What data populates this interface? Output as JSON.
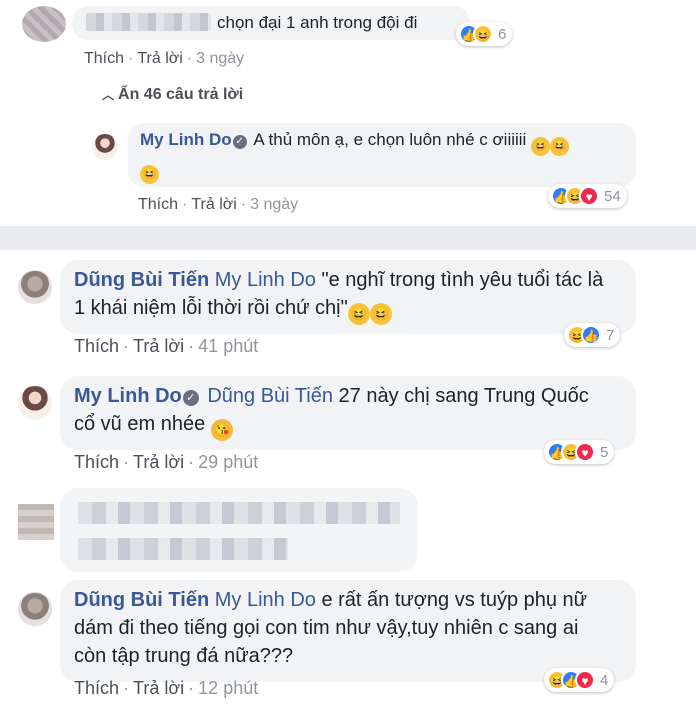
{
  "comment1": {
    "text": "chọn đại 1 anh trong đội đi",
    "reactions": {
      "icons": [
        "like-icon",
        "haha-icon"
      ],
      "count": "6"
    },
    "like_label": "Thích",
    "reply_label": "Trả lời",
    "time": "3 ngày"
  },
  "hide_replies_label": "Ẩn 46 câu trả lời",
  "reply1": {
    "author": "My Linh Do",
    "text_line1": "A thủ môn ạ, e chọn luôn nhé c ơiiiiii",
    "reactions": {
      "icons": [
        "like-icon",
        "haha-icon",
        "love-icon"
      ],
      "count": "54"
    },
    "like_label": "Thích",
    "reply_label": "Trả lời",
    "time": "3 ngày"
  },
  "reply2": {
    "author": "Dũng Bùi Tiến",
    "mention": "My Linh Do",
    "text_line1": "\"e nghĩ trong tình yêu tuổi tác là",
    "text_line2": "1 khái niệm lỗi thời rồi chứ chị\"",
    "reactions": {
      "icons": [
        "haha-icon",
        "like-icon"
      ],
      "count": "7"
    },
    "like_label": "Thích",
    "reply_label": "Trả lời",
    "time": "41 phút"
  },
  "reply3": {
    "author": "My Linh Do",
    "mention": "Dũng Bùi Tiến",
    "text_line1": "27 này chị sang Trung Quốc",
    "text_line2": "cổ vũ em nhée",
    "reactions": {
      "icons": [
        "like-icon",
        "haha-icon",
        "love-icon"
      ],
      "count": "5"
    },
    "like_label": "Thích",
    "reply_label": "Trả lời",
    "time": "29 phút"
  },
  "reply4": {
    "author": "Dũng Bùi Tiến",
    "mention": "My Linh Do",
    "text_line1": "e rất ấn tượng vs tuýp phụ nữ",
    "text_line2": "dám đi theo tiếng gọi con tim như vậy,tuy nhiên c sang ai",
    "text_line3": "còn tập trung đá nữa???",
    "reactions": {
      "icons": [
        "haha-icon",
        "like-icon",
        "love-icon"
      ],
      "count": "4"
    },
    "like_label": "Thích",
    "reply_label": "Trả lời",
    "time": "12 phút"
  },
  "colors": {
    "link_blue": "#385898",
    "bubble_gray": "#f2f3f5",
    "meta_gray": "#90949c",
    "like_blue": "#2d7ff9",
    "haha_yellow": "#f7c33c",
    "love_red": "#f0284a"
  }
}
